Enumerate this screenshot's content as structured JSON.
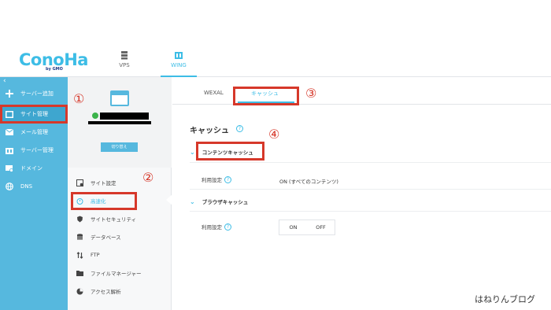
{
  "header": {
    "logo_text": "ConoHa",
    "logo_sub": "by GMO",
    "tabs": [
      {
        "label": "VPS",
        "active": false
      },
      {
        "label": "WING",
        "active": true
      }
    ]
  },
  "sidebar": {
    "back": "‹",
    "items": [
      {
        "label": "サーバー追加",
        "icon": "plus-icon"
      },
      {
        "label": "サイト管理",
        "icon": "window-icon",
        "active": true
      },
      {
        "label": "メール管理",
        "icon": "mail-icon"
      },
      {
        "label": "サーバー管理",
        "icon": "server-icon"
      },
      {
        "label": "ドメイン",
        "icon": "domain-icon"
      },
      {
        "label": "DNS",
        "icon": "globe-icon"
      }
    ]
  },
  "subsidebar": {
    "switch_button": "切り替え",
    "items": [
      {
        "label": "サイト設定",
        "icon": "settings-icon"
      },
      {
        "label": "高速化",
        "icon": "stopwatch-icon",
        "active": true
      },
      {
        "label": "サイトセキュリティ",
        "icon": "shield-icon"
      },
      {
        "label": "データベース",
        "icon": "database-icon"
      },
      {
        "label": "FTP",
        "icon": "transfer-icon"
      },
      {
        "label": "ファイルマネージャー",
        "icon": "folder-icon"
      },
      {
        "label": "アクセス解析",
        "icon": "piechart-icon"
      }
    ]
  },
  "main": {
    "tabs": [
      {
        "label": "WEXAL",
        "active": false
      },
      {
        "label": "キャッシュ",
        "active": true
      }
    ],
    "section_title": "キャッシュ",
    "groups": [
      {
        "title": "コンテンツキャッシュ",
        "row_label": "利用設定",
        "row_value": "ON (すべてのコンテンツ)"
      },
      {
        "title": "ブラウザキャッシュ",
        "row_label": "利用設定",
        "toggle_on": "ON",
        "toggle_off": "OFF"
      }
    ]
  },
  "annotations": [
    "①",
    "②",
    "③",
    "④"
  ],
  "watermark": "はねりんブログ",
  "colors": {
    "accent": "#3dbde6",
    "sidebar": "#56b8de",
    "highlight": "#d6382a"
  }
}
